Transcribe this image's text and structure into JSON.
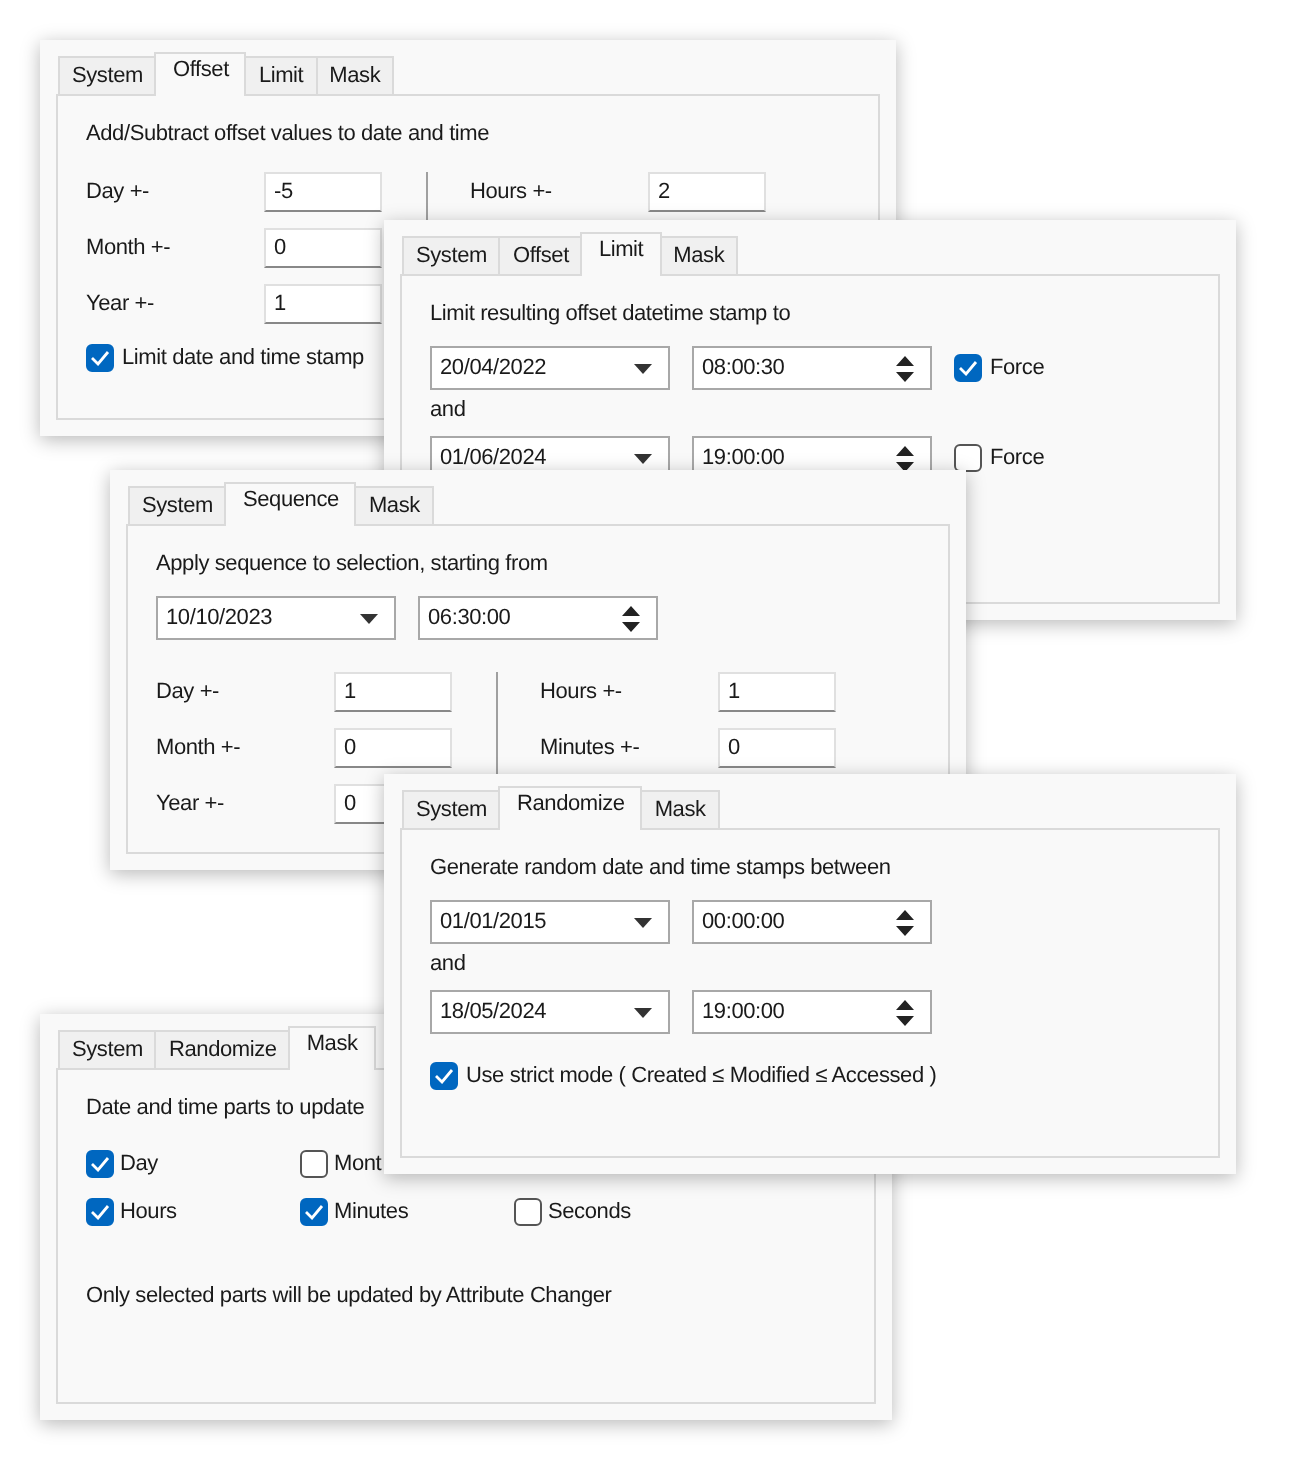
{
  "panels": [
    {
      "tabs": [
        {
          "label": "System",
          "selected": false
        },
        {
          "label": "Offset",
          "selected": true
        },
        {
          "label": "Limit",
          "selected": false
        },
        {
          "label": "Mask",
          "selected": false
        }
      ],
      "content": [
        {
          "kind": "label",
          "text": "Add/Subtract offset values to date and time"
        },
        {
          "kind": "offsets",
          "left": [
            {
              "label": "Day +-",
              "value": "-5"
            },
            {
              "label": "Month +-",
              "value": "0"
            },
            {
              "label": "Year +-",
              "value": "1"
            }
          ],
          "right": [
            {
              "label": "Hours +-",
              "value": "2"
            }
          ]
        },
        {
          "kind": "checkbox",
          "label": "Limit date and time stamp",
          "checked": true
        }
      ]
    },
    {
      "tabs": [
        {
          "label": "System",
          "selected": false
        },
        {
          "label": "Offset",
          "selected": false
        },
        {
          "label": "Limit",
          "selected": true
        },
        {
          "label": "Mask",
          "selected": false
        }
      ],
      "content": [
        {
          "kind": "label",
          "text": "Limit resulting offset datetime stamp to"
        },
        {
          "kind": "datetime",
          "date": "20/04/2022",
          "time": "08:00:30",
          "force": {
            "label": "Force",
            "checked": true
          }
        },
        {
          "kind": "and",
          "text": "and"
        },
        {
          "kind": "datetime",
          "date": "01/06/2024",
          "time": "19:00:00",
          "force": {
            "label": "Force",
            "checked": false
          }
        }
      ]
    },
    {
      "tabs": [
        {
          "label": "System",
          "selected": false
        },
        {
          "label": "Sequence",
          "selected": true
        },
        {
          "label": "Mask",
          "selected": false
        }
      ],
      "content": [
        {
          "kind": "label",
          "text": "Apply sequence to selection, starting from"
        },
        {
          "kind": "datetime",
          "date": "10/10/2023",
          "time": "06:30:00"
        },
        {
          "kind": "offsets",
          "left": [
            {
              "label": "Day +-",
              "value": "1"
            },
            {
              "label": "Month +-",
              "value": "0"
            },
            {
              "label": "Year +-",
              "value": "0"
            }
          ],
          "right": [
            {
              "label": "Hours +-",
              "value": "1"
            },
            {
              "label": "Minutes +-",
              "value": "0"
            }
          ]
        }
      ]
    },
    {
      "tabs": [
        {
          "label": "System",
          "selected": false
        },
        {
          "label": "Randomize",
          "selected": false
        },
        {
          "label": "Mask",
          "selected": true
        }
      ],
      "content": [
        {
          "kind": "label",
          "text": "Date and time parts to update"
        },
        {
          "kind": "checks",
          "items": [
            {
              "label": "Day",
              "checked": true
            },
            {
              "label": "Mont",
              "checked": false
            }
          ]
        },
        {
          "kind": "checks",
          "items": [
            {
              "label": "Hours",
              "checked": true
            },
            {
              "label": "Minutes",
              "checked": true
            },
            {
              "label": "Seconds",
              "checked": false
            }
          ]
        },
        {
          "kind": "note",
          "text": "Only selected parts will be updated by Attribute Changer"
        }
      ]
    },
    {
      "tabs": [
        {
          "label": "System",
          "selected": false
        },
        {
          "label": "Randomize",
          "selected": true
        },
        {
          "label": "Mask",
          "selected": false
        }
      ],
      "content": [
        {
          "kind": "label",
          "text": "Generate random date and time stamps between"
        },
        {
          "kind": "datetime",
          "date": "01/01/2015",
          "time": "00:00:00"
        },
        {
          "kind": "and",
          "text": "and"
        },
        {
          "kind": "datetime",
          "date": "18/05/2024",
          "time": "19:00:00"
        },
        {
          "kind": "checkbox",
          "label": "Use strict mode ( Created ≤ Modified ≤ Accessed )",
          "checked": true
        }
      ]
    }
  ]
}
